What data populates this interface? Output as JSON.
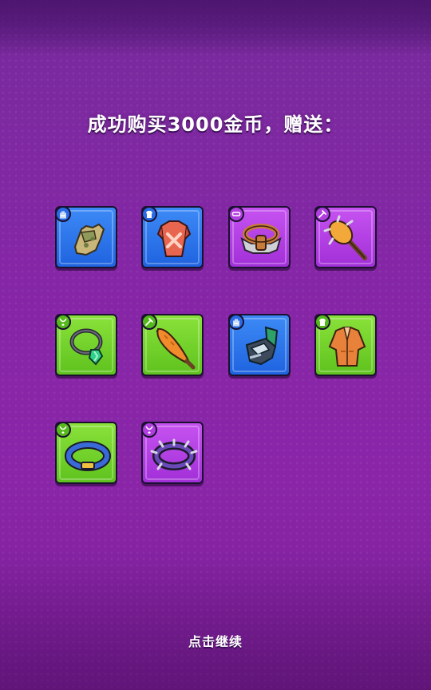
{
  "title": "成功购买3000金币，赠送：",
  "continue_label": "点击继续",
  "rarity_colors": {
    "blue": "#2a6be6",
    "purple": "#b13fe0",
    "green": "#55b81b"
  },
  "items": [
    {
      "name": "glove",
      "rarity": "blue",
      "slot": "glove-icon"
    },
    {
      "name": "armor",
      "rarity": "blue",
      "slot": "shirt-icon"
    },
    {
      "name": "belt",
      "rarity": "purple",
      "slot": "belt-icon"
    },
    {
      "name": "spiked club",
      "rarity": "purple",
      "slot": "weapon-icon"
    },
    {
      "name": "gem necklace",
      "rarity": "green",
      "slot": "necklace-icon"
    },
    {
      "name": "carrot club",
      "rarity": "green",
      "slot": "weapon-icon"
    },
    {
      "name": "gauntlet",
      "rarity": "blue",
      "slot": "glove-icon"
    },
    {
      "name": "jacket",
      "rarity": "green",
      "slot": "shirt-icon"
    },
    {
      "name": "blue collar",
      "rarity": "green",
      "slot": "necklace-icon"
    },
    {
      "name": "spiked collar",
      "rarity": "purple",
      "slot": "necklace-icon"
    }
  ]
}
